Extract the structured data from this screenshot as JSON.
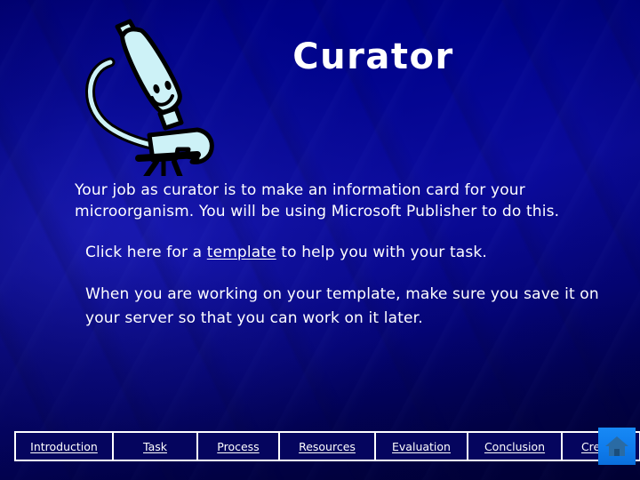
{
  "slide": {
    "title": "Curator",
    "background_color_top": "#00007e",
    "background_color_mid": "#0b0b9c",
    "background_color_bottom": "#000038",
    "text_color": "#ffffff"
  },
  "illustration": {
    "name": "microscope-clipart",
    "fill_color": "#cdf2f7",
    "outline_color": "#000000"
  },
  "body": {
    "paragraph_1": "Your job as curator is to make an information card for your microorganism.  You will be using Microsoft Publisher to do this.",
    "paragraph_2_before": "Click here for a ",
    "paragraph_2_link": "template",
    "paragraph_2_after": " to help you with your task.",
    "paragraph_3": "When you are working on your template, make sure you save it on your server so that you can work on it later."
  },
  "nav": {
    "items": [
      {
        "label": "Introduction",
        "width_class": "w-intro"
      },
      {
        "label": "Task",
        "width_class": "w-task"
      },
      {
        "label": "Process",
        "width_class": "w-proc"
      },
      {
        "label": "Resources",
        "width_class": "w-res"
      },
      {
        "label": "Evaluation",
        "width_class": "w-eval"
      },
      {
        "label": "Conclusion",
        "width_class": "w-conc"
      },
      {
        "label": "Credits",
        "width_class": "w-cred"
      }
    ],
    "border_color": "#ffffff",
    "cell_color": "#05055e"
  },
  "home_button": {
    "icon": "home-icon",
    "background_color": "#0f7ced",
    "icon_color": "#1f5f9e"
  }
}
